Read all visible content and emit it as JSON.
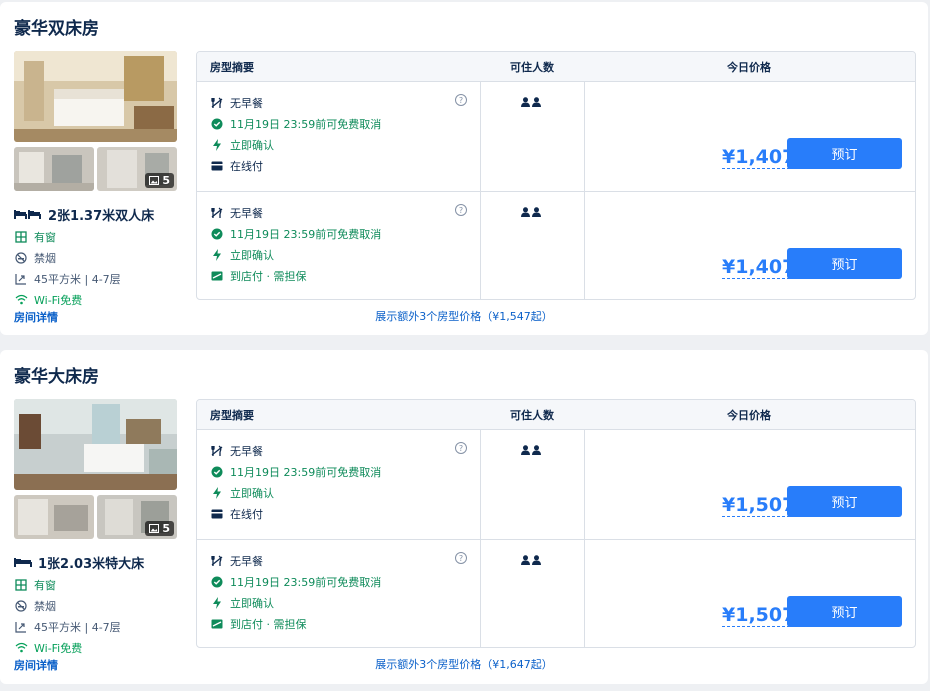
{
  "rooms": [
    {
      "name": "豪华双床房",
      "photo_count": "5",
      "bed": "2张1.37米双人床",
      "window": "有窗",
      "smoking": "禁烟",
      "area_floor": "45平方米 | 4-7层",
      "wifi": "Wi-Fi免费",
      "detail_link": "房间详情",
      "header": {
        "summary": "房型摘要",
        "occupancy": "可住人数",
        "price": "今日价格"
      },
      "offers": [
        {
          "meal": "无早餐",
          "cancel": "11月19日 23:59前可免费取消",
          "confirm": "立即确认",
          "payment": "在线付",
          "payment_icon": "card-icon",
          "price": "¥1,407",
          "book": "预订"
        },
        {
          "meal": "无早餐",
          "cancel": "11月19日 23:59前可免费取消",
          "confirm": "立即确认",
          "payment": "到店付 · 需担保",
          "payment_icon": "pay-at-hotel-icon",
          "price": "¥1,407",
          "book": "预订"
        }
      ],
      "more_link": "展示额外3个房型价格（¥1,547起）"
    },
    {
      "name": "豪华大床房",
      "photo_count": "5",
      "bed": "1张2.03米特大床",
      "window": "有窗",
      "smoking": "禁烟",
      "area_floor": "45平方米 | 4-7层",
      "wifi": "Wi-Fi免费",
      "detail_link": "房间详情",
      "header": {
        "summary": "房型摘要",
        "occupancy": "可住人数",
        "price": "今日价格"
      },
      "offers": [
        {
          "meal": "无早餐",
          "cancel": "11月19日 23:59前可免费取消",
          "confirm": "立即确认",
          "payment": "在线付",
          "payment_icon": "card-icon",
          "price": "¥1,507",
          "book": "预订"
        },
        {
          "meal": "无早餐",
          "cancel": "11月19日 23:59前可免费取消",
          "confirm": "立即确认",
          "payment": "到店付 · 需担保",
          "payment_icon": "pay-at-hotel-icon",
          "price": "¥1,507",
          "book": "预订"
        }
      ],
      "more_link": "展示额外3个房型价格（¥1,647起）"
    }
  ],
  "colors": {
    "accent": "#287dfa",
    "green": "#0e8b5a",
    "text": "#0f294d"
  }
}
